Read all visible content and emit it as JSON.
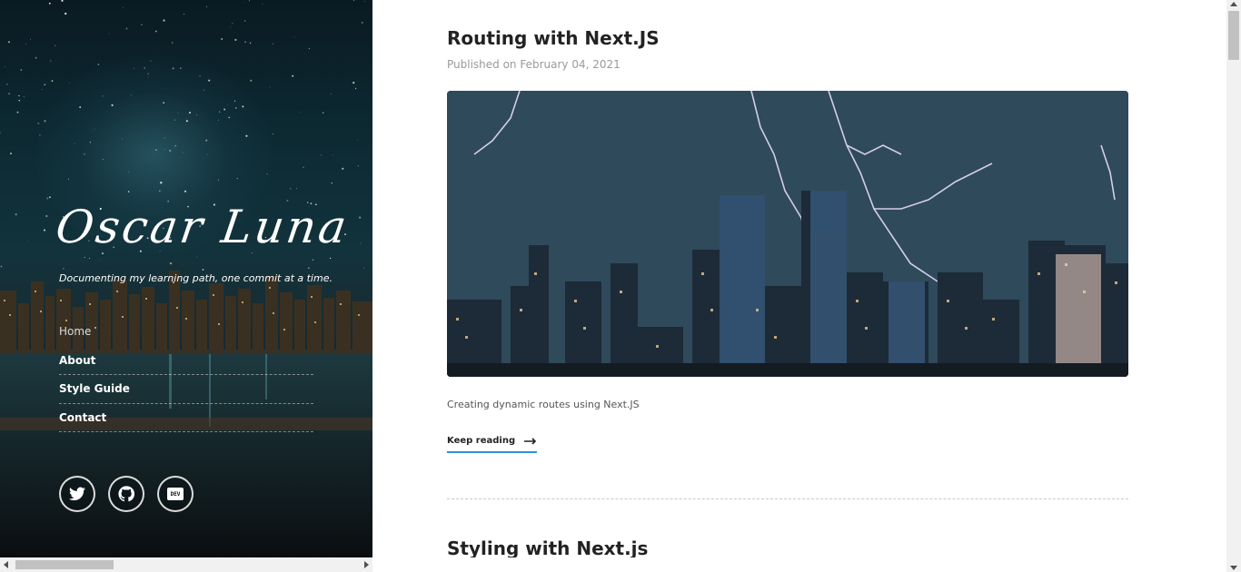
{
  "sidebar": {
    "brand": "Oscar Luna",
    "tagline": "Documenting my learning path, one commit at a time.",
    "nav": [
      {
        "label": "Home",
        "active": true
      },
      {
        "label": "About",
        "active": false
      },
      {
        "label": "Style Guide",
        "active": false
      },
      {
        "label": "Contact",
        "active": false
      }
    ],
    "socials": [
      {
        "name": "twitter",
        "icon": "twitter-icon"
      },
      {
        "name": "github",
        "icon": "github-icon"
      },
      {
        "name": "dev",
        "icon": "dev-icon",
        "badge_text": "DEV"
      }
    ]
  },
  "posts": [
    {
      "title": "Routing with Next.JS",
      "meta": "Published on February 04, 2021",
      "image_alt": "city-lightning",
      "excerpt": "Creating dynamic routes using Next.JS",
      "read_more": "Keep reading"
    },
    {
      "title": "Styling with Next.js"
    }
  ],
  "colors": {
    "accent": "#2f8fd8",
    "text": "#222222",
    "muted": "#9a9a9a"
  }
}
